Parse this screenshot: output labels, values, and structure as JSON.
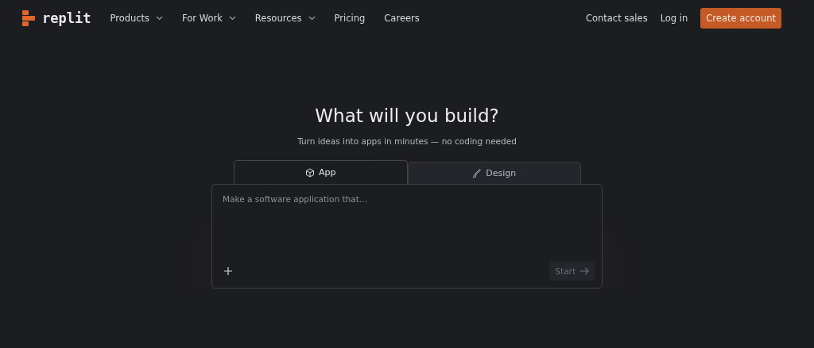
{
  "logo": {
    "text": "replit"
  },
  "nav": [
    {
      "label": "Products",
      "dropdown": true
    },
    {
      "label": "For Work",
      "dropdown": true
    },
    {
      "label": "Resources",
      "dropdown": true
    },
    {
      "label": "Pricing",
      "dropdown": false
    },
    {
      "label": "Careers",
      "dropdown": false
    }
  ],
  "actions": [
    {
      "label": "Contact sales",
      "kind": "link"
    },
    {
      "label": "Log in",
      "kind": "link"
    },
    {
      "label": "Create account",
      "kind": "primary"
    }
  ],
  "hero": {
    "title": "What will you build?",
    "subtitle": "Turn ideas into apps in minutes — no coding needed"
  },
  "tabs": [
    {
      "label": "App",
      "selected": true
    },
    {
      "label": "Design",
      "selected": false
    }
  ],
  "prompt": {
    "placeholder": "Make a software application that...",
    "submit": "Start"
  }
}
